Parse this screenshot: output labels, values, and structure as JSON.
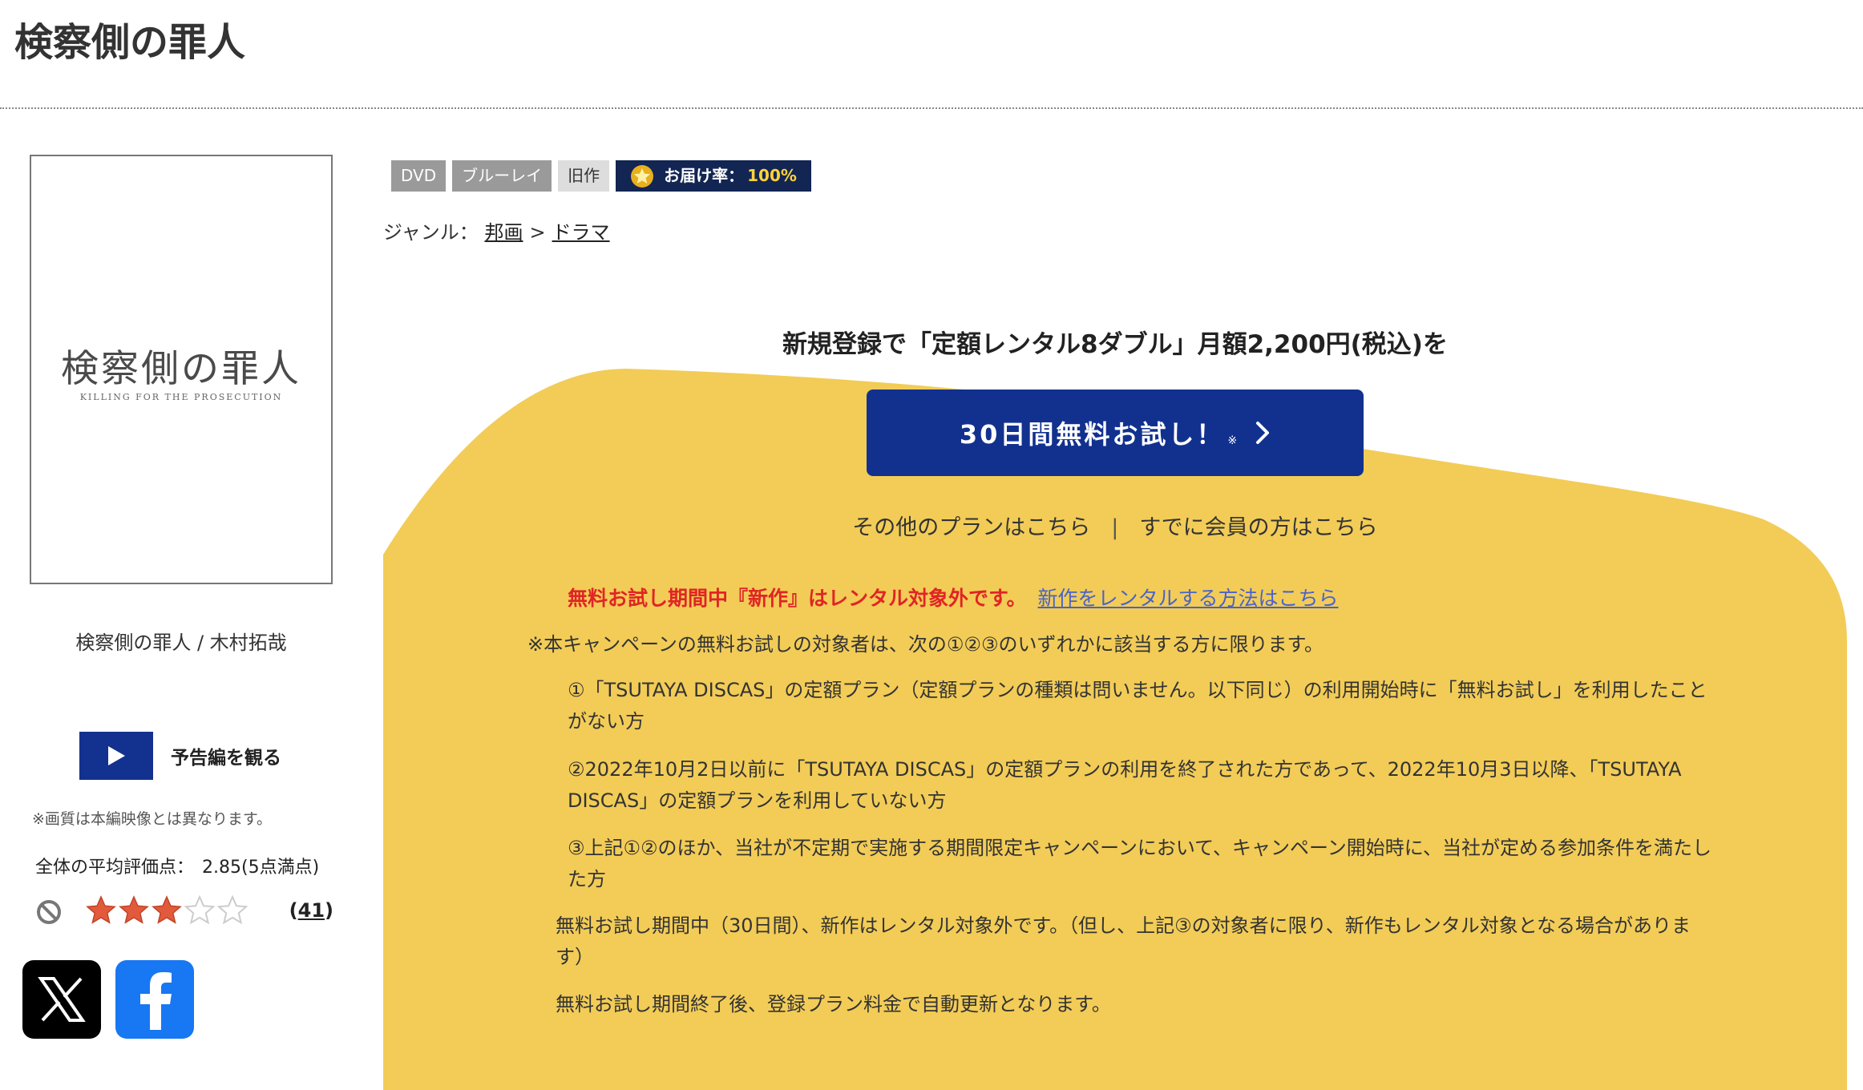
{
  "page": {
    "title": "検察側の罪人"
  },
  "cover": {
    "title": "検察側の罪人",
    "subtitle": "KILLING FOR THE PROSECUTION"
  },
  "product": {
    "caption": "検察側の罪人 / 木村拓哉",
    "trailer_label": "予告編を観る",
    "quality_note": "※画質は本編映像とは異なります。",
    "avg_rating_label": "全体の平均評価点：",
    "avg_rating_value": "2.85(5点満点)",
    "rating": 3,
    "rating_max": 5,
    "rating_count_open": "(",
    "rating_count": "41",
    "rating_count_close": ")"
  },
  "icons": {
    "play": "play-icon",
    "no_rating": "no-entry-icon",
    "star": "star-icon",
    "x_logo": "x-logo-icon",
    "facebook_logo": "facebook-logo-icon",
    "chevron": "chevron-right-icon",
    "delivery_star": "star-badge-icon"
  },
  "tags": {
    "dvd": "DVD",
    "bluray": "ブルーレイ",
    "old": "旧作",
    "delivery_label": "お届け率：",
    "delivery_value": "100%"
  },
  "genre": {
    "label": "ジャンル：",
    "level1": "邦画",
    "separator": ">",
    "level2": "ドラマ"
  },
  "promo": {
    "headline": "新規登録で「定額レンタル8ダブル」月額2,200円(税込)を",
    "trial_button": "30日間無料お試し！",
    "trial_note": "※",
    "other_plans": "その他のプランはこちら",
    "links_divider": "|",
    "member_login": "すでに会員の方はこちら",
    "notice_red": "無料お試し期間中『新作』はレンタル対象外です。",
    "notice_link": "新作をレンタルする方法はこちら",
    "eligibility": "※本キャンペーンの無料お試しの対象者は、次の①②③のいずれかに該当する方に限ります。",
    "condition1": "①「TSUTAYA DISCAS」の定額プラン（定額プランの種類は問いません。以下同じ）の利用開始時に「無料お試し」を利用したことがない方",
    "condition2": "②2022年10月2日以前に「TSUTAYA DISCAS」の定額プランの利用を終了された方であって、2022年10月3日以降、「TSUTAYA DISCAS」の定額プランを利用していない方",
    "condition3": "③上記①②のほか、当社が不定期で実施する期間限定キャンペーンにおいて、キャンペーン開始時に、当社が定める参加条件を満たした方",
    "note1": "無料お試し期間中（30日間）、新作はレンタル対象外です。（但し、上記③の対象者に限り、新作もレンタル対象となる場合があります）",
    "note2": "無料お試し期間終了後、登録プラン料金で自動更新となります。"
  },
  "colors": {
    "promo_background": "#f2cc57",
    "trial_button": "#12318f",
    "notice_red": "#e02525",
    "notice_link": "#4a63c8",
    "delivery_badge": "#122553",
    "delivery_value": "#ffd23a",
    "star_filled": "#e25a3c",
    "play_box": "#13318e",
    "facebook": "#1877f2"
  }
}
